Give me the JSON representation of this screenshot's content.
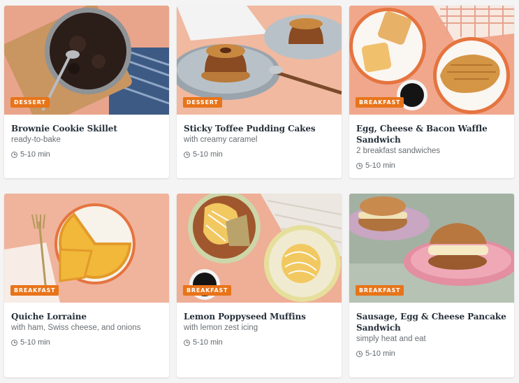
{
  "products": [
    {
      "badge": "DESSERT",
      "title": "Brownie Cookie Skillet",
      "subtitle": "ready-to-bake",
      "time": "5-10 min"
    },
    {
      "badge": "DESSERT",
      "title": "Sticky Toffee Pudding Cakes",
      "subtitle": "with creamy caramel",
      "time": "5-10 min"
    },
    {
      "badge": "BREAKFAST",
      "title": "Egg, Cheese & Bacon Waffle Sandwich",
      "subtitle": "2 breakfast sandwiches",
      "time": "5-10 min"
    },
    {
      "badge": "BREAKFAST",
      "title": "Quiche Lorraine",
      "subtitle": "with ham, Swiss cheese, and onions",
      "time": "5-10 min"
    },
    {
      "badge": "BREAKFAST",
      "title": "Lemon Poppyseed Muffins",
      "subtitle": "with lemon zest icing",
      "time": "5-10 min"
    },
    {
      "badge": "BREAKFAST",
      "title": "Sausage, Egg & Cheese Pancake Sandwich",
      "subtitle": "simply heat and eat",
      "time": "5-10 min"
    }
  ],
  "colors": {
    "badge": "#e8741a",
    "title": "#26303a",
    "subtitle": "#6a6f74",
    "page_background": "#f4f4f4"
  },
  "icons": [
    "clock-icon"
  ]
}
